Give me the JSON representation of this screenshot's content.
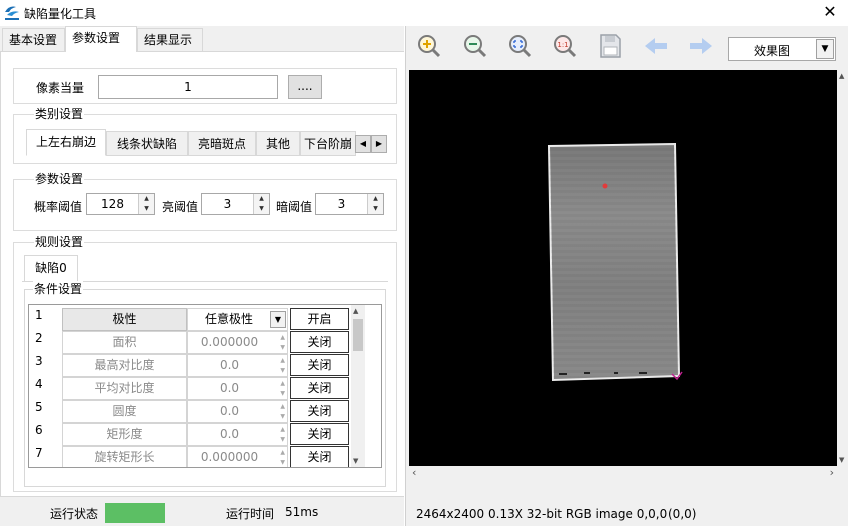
{
  "window": {
    "title": "缺陷量化工具"
  },
  "tabs": [
    {
      "label": "基本设置"
    },
    {
      "label": "参数设置"
    },
    {
      "label": "结果显示"
    }
  ],
  "pixel": {
    "label": "像素当量",
    "value": "1",
    "browse": "...."
  },
  "category": {
    "label": "类别设置",
    "tabs": [
      "上左右崩边",
      "线条状缺陷",
      "亮暗斑点",
      "其他",
      "下台阶崩"
    ]
  },
  "params": {
    "label": "参数设置",
    "prob_label": "概率阈值",
    "prob_value": "128",
    "bright_label": "亮阈值",
    "bright_value": "3",
    "dark_label": "暗阈值",
    "dark_value": "3"
  },
  "rules": {
    "label": "规则设置",
    "defect_tab": "缺陷0",
    "cond_label": "条件设置",
    "header": {
      "num": "1",
      "name": "极性",
      "value": "任意极性",
      "toggle": "开启"
    },
    "rows": [
      {
        "num": "2",
        "name": "面积",
        "value": "0.000000",
        "toggle": "关闭"
      },
      {
        "num": "3",
        "name": "最高对比度",
        "value": "0.0",
        "toggle": "关闭"
      },
      {
        "num": "4",
        "name": "平均对比度",
        "value": "0.0",
        "toggle": "关闭"
      },
      {
        "num": "5",
        "name": "圆度",
        "value": "0.0",
        "toggle": "关闭"
      },
      {
        "num": "6",
        "name": "矩形度",
        "value": "0.0",
        "toggle": "关闭"
      },
      {
        "num": "7",
        "name": "旋转矩形长",
        "value": "0.000000",
        "toggle": "关闭"
      }
    ]
  },
  "status": {
    "run_label": "运行状态",
    "run_color": "#5cbf64",
    "time_label": "运行时间",
    "time_value": "51ms"
  },
  "toolbar": {
    "view_select": "效果图"
  },
  "image_status": {
    "info": "2464x2400 0.13X 32-bit RGB image 0,0,0",
    "coord": "(0,0)"
  }
}
